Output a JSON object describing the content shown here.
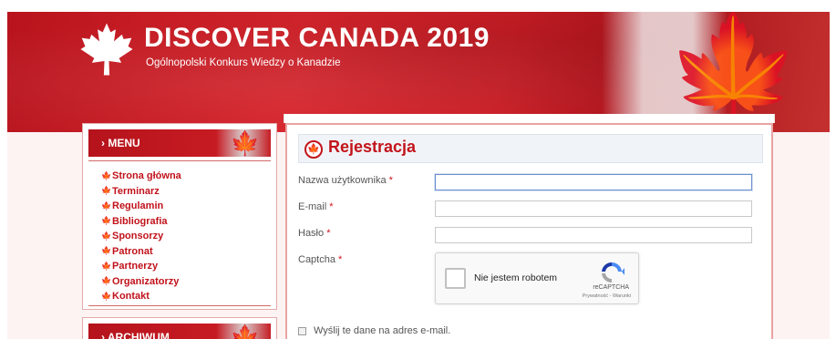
{
  "header": {
    "title": "DISCOVER CANADA 2019",
    "subtitle": "Ogólnopolski Konkurs Wiedzy o Kanadzie",
    "logo_icon": "maple-leaf-icon"
  },
  "sidebar": {
    "menu_heading": "› MENU",
    "items": [
      {
        "label": "Strona główna"
      },
      {
        "label": "Terminarz"
      },
      {
        "label": "Regulamin"
      },
      {
        "label": "Bibliografia"
      },
      {
        "label": "Sponsorzy"
      },
      {
        "label": "Patronat"
      },
      {
        "label": "Partnerzy"
      },
      {
        "label": "Organizatorzy"
      },
      {
        "label": "Kontakt"
      }
    ],
    "archive_heading": "› ARCHIWUM"
  },
  "form": {
    "title": "Rejestracja",
    "fields": [
      {
        "label": "Nazwa użytkownika",
        "required": "*",
        "value": ""
      },
      {
        "label": "E-mail",
        "required": "*",
        "value": ""
      },
      {
        "label": "Hasło",
        "required": "*",
        "value": ""
      }
    ],
    "captcha_label": "Captcha",
    "captcha_required": "*",
    "captcha": {
      "checkbox_text": "Nie jestem robotem",
      "brand": "reCAPTCHA",
      "links": "Prywatność - Warunki"
    },
    "send_copy_label": "Wyślij te dane na adres e-mail."
  },
  "colors": {
    "brand_red": "#c3131b",
    "panel_border": "#e9a3a3"
  }
}
